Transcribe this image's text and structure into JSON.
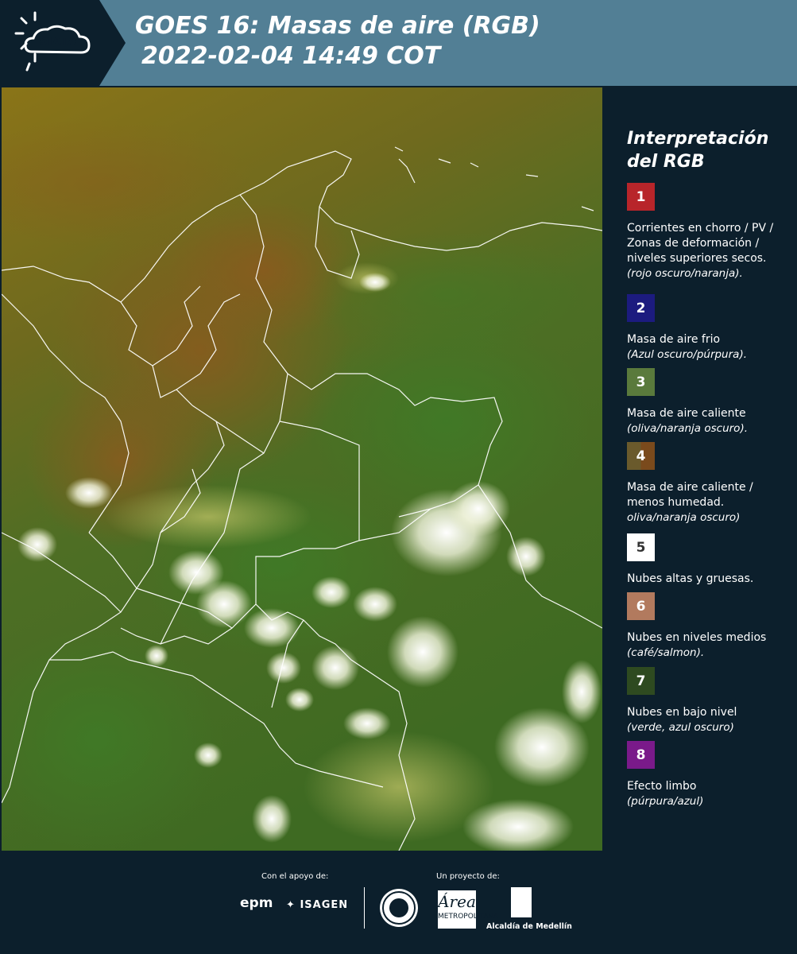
{
  "header": {
    "logo": "SIATA",
    "title_line1": "GOES 16: Masas de aire (RGB)",
    "title_line2": "2022-02-04 14:49 COT"
  },
  "map": {
    "product": "GOES 16 Air Mass RGB satellite image"
  },
  "legend": {
    "title": "Interpretación del RGB",
    "items": [
      {
        "num": "1",
        "color": "#b8252a",
        "desc": "Corrientes en chorro / PV / Zonas de deformación / niveles superiores secos.",
        "note": "(rojo oscuro/naranja)."
      },
      {
        "num": "2",
        "color": "#1c1b7f",
        "desc": "Masa de aire frio",
        "note": "(Azul oscuro/púrpura)."
      },
      {
        "num": "3",
        "color": "#5a7a3c",
        "desc": "Masa de aire caliente",
        "note": "(oliva/naranja oscuro)."
      },
      {
        "num": "4",
        "color": "#6a5a2c",
        "color2": "#7a4a1c",
        "desc": "Masa de aire caliente / menos humedad.",
        "note": "oliva/naranja oscuro)"
      },
      {
        "num": "5",
        "color": "#ffffff",
        "desc": "Nubes altas y gruesas.",
        "note": ""
      },
      {
        "num": "6",
        "color": "#b27a5e",
        "desc": "Nubes en niveles medios",
        "note": "(café/salmon)."
      },
      {
        "num": "7",
        "color": "#2e4a20",
        "desc": "Nubes en bajo nivel",
        "note": "(verde, azul oscuro)"
      },
      {
        "num": "8",
        "color": "#7a1a8a",
        "desc": "Efecto limbo",
        "note": "(púrpura/azul)"
      }
    ]
  },
  "footer": {
    "support_label": "Con el apoyo de:",
    "project_label": "Un proyecto de:",
    "epm": "epm",
    "isagen": "ISAGEN",
    "area": "Área",
    "area_sub": "METROPOLITANA",
    "alcaldia": "Alcaldía de Medellín"
  }
}
